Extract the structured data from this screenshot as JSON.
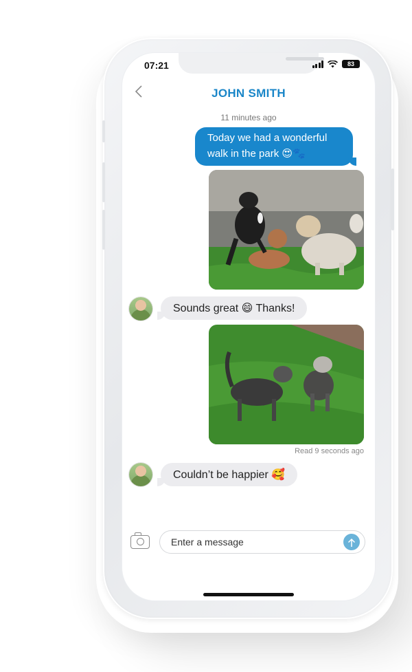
{
  "status_bar": {
    "time": "07:21",
    "battery": "83"
  },
  "header": {
    "title": "JOHN SMITH",
    "back_icon": "chevron-left-icon"
  },
  "messages": {
    "timestamp": "11 minutes ago",
    "outgoing_text": "Today we had a wonderful walk in the park",
    "outgoing_emoji": "😍🐾",
    "reply1_text": "Sounds great",
    "reply1_emoji": "😄",
    "reply1_suffix": "Thanks!",
    "read_receipt": "Read 9 seconds ago",
    "reply2_text": "Couldn’t be happier",
    "reply2_emoji": "🥰"
  },
  "composer": {
    "placeholder": "Enter a message",
    "camera_icon": "camera-icon",
    "send_icon": "arrow-up-icon"
  },
  "colors": {
    "accent": "#1a86c8",
    "outgoing_bubble": "#1987cc",
    "incoming_bubble": "#ececef",
    "send_button": "#6ab3d9"
  }
}
